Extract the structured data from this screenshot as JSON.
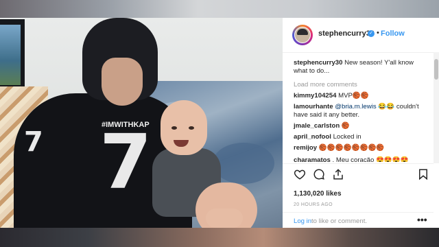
{
  "post": {
    "username": "stephencurry30",
    "follow_label": "Follow",
    "separator": "•",
    "verified_glyph": "✓"
  },
  "photo": {
    "jersey_number": "7",
    "sleeve_number": "7",
    "jersey_tag": "#IMWITHKAP"
  },
  "comments": [
    {
      "user": "stephencurry30",
      "text": " New season! Y'all know what to do..."
    },
    {
      "user": "kimmy104254",
      "text": " MVP🏀🏀"
    },
    {
      "user": "lamourhante",
      "mention": " @bria.m.lewis",
      "text": " 😂😂 couldn't have said it any better."
    },
    {
      "user": "jmale_carlston",
      "text": " 🏀"
    },
    {
      "user": "april_nofool",
      "text": " Locked in"
    },
    {
      "user": "remijoy",
      "text": " 🏀🏀🏀🏀🏀🏀🏀🏀"
    },
    {
      "user": "charamatos",
      "text": " . Meu coração 😍😍😍😍"
    }
  ],
  "load_more_label": "Load more comments",
  "likes": "1,130,020 likes",
  "time_ago": "20 HOURS AGO",
  "login": {
    "link": "Log in",
    "text": "to like or comment."
  },
  "more_glyph": "•••",
  "icons": [
    "heart-icon",
    "comment-icon",
    "share-icon",
    "bookmark-icon"
  ]
}
